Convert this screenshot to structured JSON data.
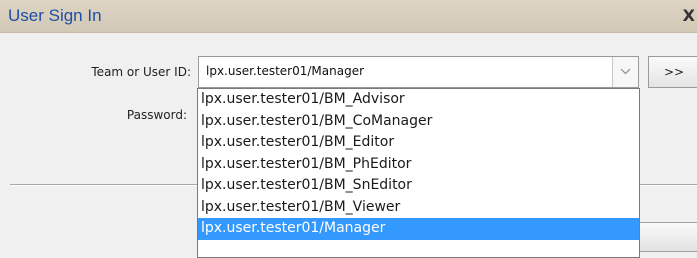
{
  "window": {
    "title": "User Sign In",
    "close_glyph": "X"
  },
  "form": {
    "team_label": "Team or User ID:",
    "team_value": "lpx.user.tester01/Manager",
    "password_label": "Password:",
    "next_button_label": ">>"
  },
  "dropdown": {
    "options": [
      "lpx.user.tester01/BM_Advisor",
      "lpx.user.tester01/BM_CoManager",
      "lpx.user.tester01/BM_Editor",
      "lpx.user.tester01/BM_PhEditor",
      "lpx.user.tester01/BM_SnEditor",
      "lpx.user.tester01/BM_Viewer",
      "lpx.user.tester01/Manager"
    ],
    "selected_index": 6
  },
  "colors": {
    "title_text": "#1f4fa6",
    "selection": "#3399ff",
    "titlebar": "#d8cfbd"
  },
  "icons": {
    "close": "close-icon",
    "dropdown_arrow": "chevron-down-icon"
  }
}
